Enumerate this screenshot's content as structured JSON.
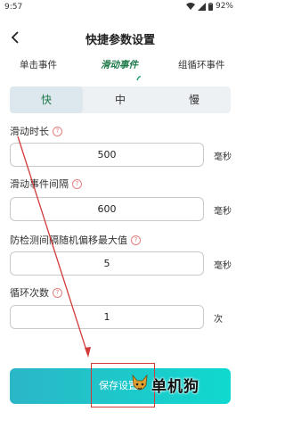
{
  "status_bar": {
    "time": "9:57",
    "battery": "92%"
  },
  "header": {
    "title": "快捷参数设置"
  },
  "tabs": [
    {
      "label": "单击事件",
      "active": false
    },
    {
      "label": "滑动事件",
      "active": true
    },
    {
      "label": "组循环事件",
      "active": false
    }
  ],
  "speed": {
    "options": [
      "快",
      "中",
      "慢"
    ],
    "selected": "快"
  },
  "fields": [
    {
      "label": "滑动时长",
      "value": "500",
      "unit": "毫秒"
    },
    {
      "label": "滑动事件间隔",
      "value": "600",
      "unit": "毫秒"
    },
    {
      "label": "防检测间隔随机偏移最大值",
      "value": "5",
      "unit": "毫秒"
    },
    {
      "label": "循环次数",
      "value": "1",
      "unit": "次"
    }
  ],
  "save_button": {
    "label": "保存设置"
  },
  "watermark": {
    "text": "单机狗"
  },
  "colors": {
    "accent": "#1f7a4a",
    "button_start": "#2bb6c6",
    "button_end": "#10d9cf",
    "annotation": "#d23a3a"
  },
  "icons": {
    "back": "chevron-left-icon",
    "help": "question-circle-icon",
    "wifi": "wifi-icon",
    "signal": "signal-icon",
    "battery": "battery-icon"
  }
}
